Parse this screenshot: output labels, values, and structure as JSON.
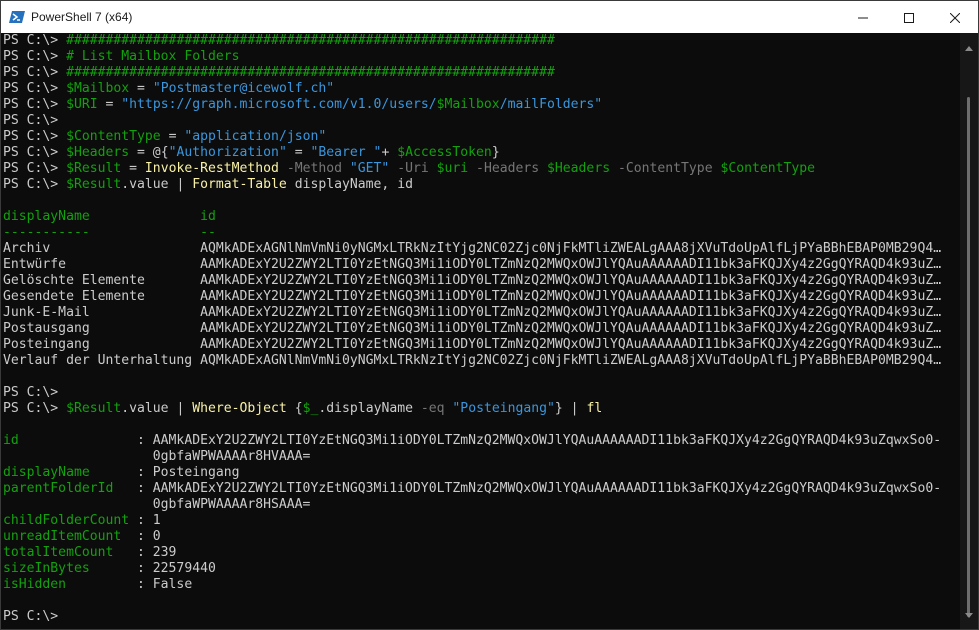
{
  "window": {
    "title": "PowerShell 7 (x64)",
    "icon": "powershell-icon",
    "controls": [
      "minimize-icon",
      "maximize-icon",
      "close-icon"
    ]
  },
  "colors": {
    "default": "#cccccc",
    "comment": "#13a10e",
    "variable": "#13a10e",
    "string": "#3a96dd",
    "command": "#f9f1a5",
    "parameter": "#767676",
    "operator": "#767676",
    "header": "#13a10e",
    "output_label": "#13a10e"
  },
  "terminal": {
    "lines": [
      [
        {
          "t": "PS C:\\> ",
          "c": "default"
        },
        {
          "t": "##############################################################",
          "c": "comment"
        }
      ],
      [
        {
          "t": "PS C:\\> ",
          "c": "default"
        },
        {
          "t": "# List Mailbox Folders",
          "c": "comment"
        }
      ],
      [
        {
          "t": "PS C:\\> ",
          "c": "default"
        },
        {
          "t": "##############################################################",
          "c": "comment"
        }
      ],
      [
        {
          "t": "PS C:\\> ",
          "c": "default"
        },
        {
          "t": "$Mailbox",
          "c": "variable"
        },
        {
          "t": " = ",
          "c": "default"
        },
        {
          "t": "\"Postmaster@icewolf.ch\"",
          "c": "string"
        }
      ],
      [
        {
          "t": "PS C:\\> ",
          "c": "default"
        },
        {
          "t": "$URI",
          "c": "variable"
        },
        {
          "t": " = ",
          "c": "default"
        },
        {
          "t": "\"https://graph.microsoft.com/v1.0/users/",
          "c": "string"
        },
        {
          "t": "$Mailbox",
          "c": "variable"
        },
        {
          "t": "/mailFolders\"",
          "c": "string"
        }
      ],
      [
        {
          "t": "PS C:\\>",
          "c": "default"
        }
      ],
      [
        {
          "t": "PS C:\\> ",
          "c": "default"
        },
        {
          "t": "$ContentType",
          "c": "variable"
        },
        {
          "t": " = ",
          "c": "default"
        },
        {
          "t": "\"application/json\"",
          "c": "string"
        }
      ],
      [
        {
          "t": "PS C:\\> ",
          "c": "default"
        },
        {
          "t": "$Headers",
          "c": "variable"
        },
        {
          "t": " = @{",
          "c": "default"
        },
        {
          "t": "\"Authorization\"",
          "c": "string"
        },
        {
          "t": " = ",
          "c": "default"
        },
        {
          "t": "\"Bearer \"",
          "c": "string"
        },
        {
          "t": "+ ",
          "c": "default"
        },
        {
          "t": "$AccessToken",
          "c": "variable"
        },
        {
          "t": "}",
          "c": "default"
        }
      ],
      [
        {
          "t": "PS C:\\> ",
          "c": "default"
        },
        {
          "t": "$Result",
          "c": "variable"
        },
        {
          "t": " = ",
          "c": "default"
        },
        {
          "t": "Invoke-RestMethod",
          "c": "command"
        },
        {
          "t": " -Method ",
          "c": "parameter"
        },
        {
          "t": "\"GET\"",
          "c": "string"
        },
        {
          "t": " -Uri ",
          "c": "parameter"
        },
        {
          "t": "$uri",
          "c": "variable"
        },
        {
          "t": " -Headers ",
          "c": "parameter"
        },
        {
          "t": "$Headers",
          "c": "variable"
        },
        {
          "t": " -ContentType ",
          "c": "parameter"
        },
        {
          "t": "$ContentType",
          "c": "variable"
        }
      ],
      [
        {
          "t": "PS C:\\> ",
          "c": "default"
        },
        {
          "t": "$Result",
          "c": "variable"
        },
        {
          "t": ".value | ",
          "c": "default"
        },
        {
          "t": "Format-Table",
          "c": "command"
        },
        {
          "t": " displayName, id",
          "c": "default"
        }
      ],
      [],
      [
        {
          "t": "displayName              id",
          "c": "header"
        }
      ],
      [
        {
          "t": "-----------              --",
          "c": "header"
        }
      ],
      [
        {
          "t": "Archiv                   AQMkADExAGNlNmVmNi0yNGMxLTRkNzItYjg2NC02Zjc0NjFkMTliZWEALgAAA8jXVuTdoUpAlfLjPYaBBhEBAP0MB29Q4…",
          "c": "default"
        }
      ],
      [
        {
          "t": "Entwürfe                 AAMkADExY2U2ZWY2LTI0YzEtNGQ3Mi1iODY0LTZmNzQ2MWQxOWJlYQAuAAAAAADI11bk3aFKQJXy4z2GgQYRAQD4k93uZ…",
          "c": "default"
        }
      ],
      [
        {
          "t": "Gelöschte Elemente       AAMkADExY2U2ZWY2LTI0YzEtNGQ3Mi1iODY0LTZmNzQ2MWQxOWJlYQAuAAAAAADI11bk3aFKQJXy4z2GgQYRAQD4k93uZ…",
          "c": "default"
        }
      ],
      [
        {
          "t": "Gesendete Elemente       AAMkADExY2U2ZWY2LTI0YzEtNGQ3Mi1iODY0LTZmNzQ2MWQxOWJlYQAuAAAAAADI11bk3aFKQJXy4z2GgQYRAQD4k93uZ…",
          "c": "default"
        }
      ],
      [
        {
          "t": "Junk-E-Mail              AAMkADExY2U2ZWY2LTI0YzEtNGQ3Mi1iODY0LTZmNzQ2MWQxOWJlYQAuAAAAAADI11bk3aFKQJXy4z2GgQYRAQD4k93uZ…",
          "c": "default"
        }
      ],
      [
        {
          "t": "Postausgang              AAMkADExY2U2ZWY2LTI0YzEtNGQ3Mi1iODY0LTZmNzQ2MWQxOWJlYQAuAAAAAADI11bk3aFKQJXy4z2GgQYRAQD4k93uZ…",
          "c": "default"
        }
      ],
      [
        {
          "t": "Posteingang              AAMkADExY2U2ZWY2LTI0YzEtNGQ3Mi1iODY0LTZmNzQ2MWQxOWJlYQAuAAAAAADI11bk3aFKQJXy4z2GgQYRAQD4k93uZ…",
          "c": "default"
        }
      ],
      [
        {
          "t": "Verlauf der Unterhaltung AQMkADExAGNlNmVmNi0yNGMxLTRkNzItYjg2NC02Zjc0NjFkMTliZWEALgAAA8jXVuTdoUpAlfLjPYaBBhEBAP0MB29Q4…",
          "c": "default"
        }
      ],
      [],
      [
        {
          "t": "PS C:\\>",
          "c": "default"
        }
      ],
      [
        {
          "t": "PS C:\\> ",
          "c": "default"
        },
        {
          "t": "$Result",
          "c": "variable"
        },
        {
          "t": ".value | ",
          "c": "default"
        },
        {
          "t": "Where-Object",
          "c": "command"
        },
        {
          "t": " {",
          "c": "default"
        },
        {
          "t": "$_",
          "c": "variable"
        },
        {
          "t": ".displayName ",
          "c": "default"
        },
        {
          "t": "-eq",
          "c": "parameter"
        },
        {
          "t": " ",
          "c": "default"
        },
        {
          "t": "\"Posteingang\"",
          "c": "string"
        },
        {
          "t": "} | ",
          "c": "default"
        },
        {
          "t": "fl",
          "c": "command"
        }
      ],
      [],
      [
        {
          "t": "id               ",
          "c": "output_label"
        },
        {
          "t": ": AAMkADExY2U2ZWY2LTI0YzEtNGQ3Mi1iODY0LTZmNzQ2MWQxOWJlYQAuAAAAAADI11bk3aFKQJXy4z2GgQYRAQD4k93uZqwxSo0-",
          "c": "default"
        }
      ],
      [
        {
          "t": "                   0gbfaWPWAAAAr8HVAAA=",
          "c": "default"
        }
      ],
      [
        {
          "t": "displayName      ",
          "c": "output_label"
        },
        {
          "t": ": Posteingang",
          "c": "default"
        }
      ],
      [
        {
          "t": "parentFolderId   ",
          "c": "output_label"
        },
        {
          "t": ": AAMkADExY2U2ZWY2LTI0YzEtNGQ3Mi1iODY0LTZmNzQ2MWQxOWJlYQAuAAAAAADI11bk3aFKQJXy4z2GgQYRAQD4k93uZqwxSo0-",
          "c": "default"
        }
      ],
      [
        {
          "t": "                   0gbfaWPWAAAAr8HSAAA=",
          "c": "default"
        }
      ],
      [
        {
          "t": "childFolderCount ",
          "c": "output_label"
        },
        {
          "t": ": 1",
          "c": "default"
        }
      ],
      [
        {
          "t": "unreadItemCount  ",
          "c": "output_label"
        },
        {
          "t": ": 0",
          "c": "default"
        }
      ],
      [
        {
          "t": "totalItemCount   ",
          "c": "output_label"
        },
        {
          "t": ": 239",
          "c": "default"
        }
      ],
      [
        {
          "t": "sizeInBytes      ",
          "c": "output_label"
        },
        {
          "t": ": 22579440",
          "c": "default"
        }
      ],
      [
        {
          "t": "isHidden         ",
          "c": "output_label"
        },
        {
          "t": ": False",
          "c": "default"
        }
      ],
      [],
      [
        {
          "t": "PS C:\\>",
          "c": "default"
        }
      ]
    ]
  }
}
